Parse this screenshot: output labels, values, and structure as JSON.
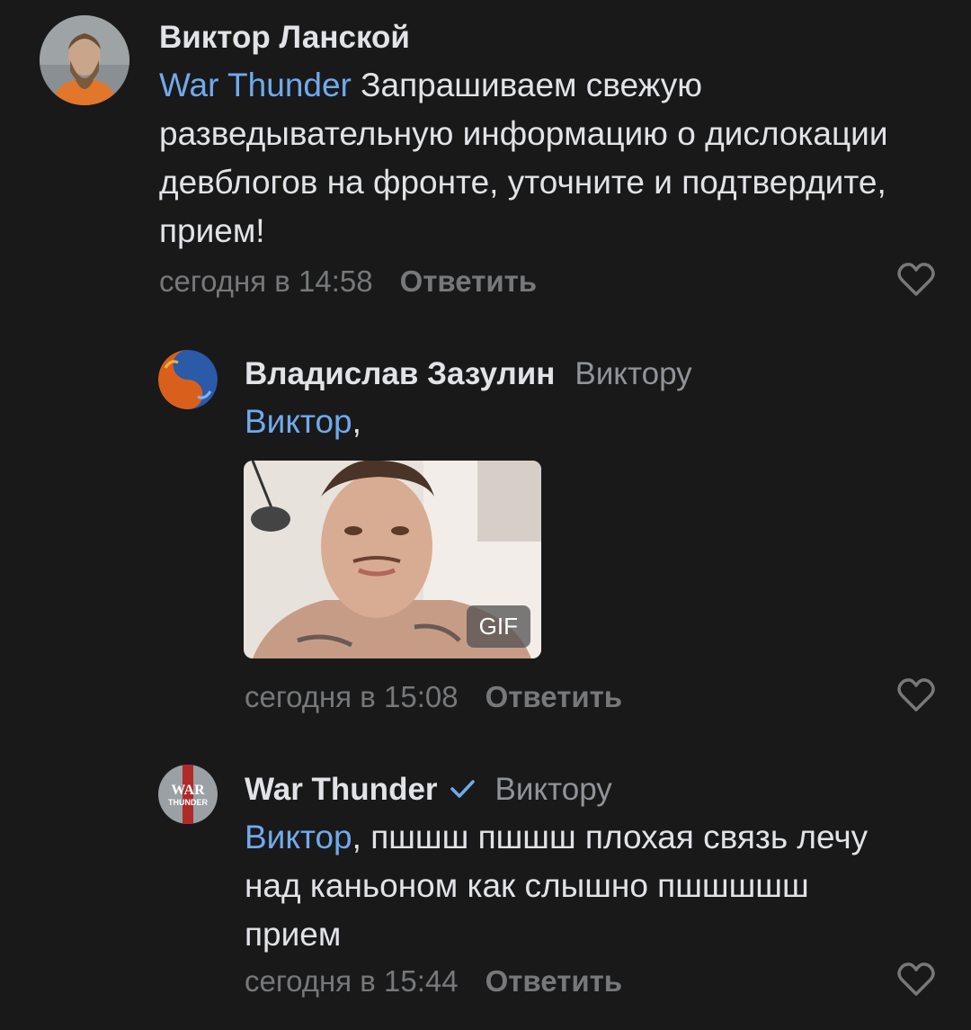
{
  "comments": [
    {
      "author": "Виктор Ланской",
      "reply_to": "",
      "mention": "War Thunder",
      "text": " Запрашиваем свежую разведывательную информацию о дислокации девблогов на фронте, уточните и подтвердите, прием!",
      "time": "сегодня в 14:58",
      "reply_label": "Ответить"
    },
    {
      "author": "Владислав Зазулин",
      "reply_to": "Виктору",
      "mention": "Виктор",
      "text": ",",
      "gif_label": "GIF",
      "time": "сегодня в 15:08",
      "reply_label": "Ответить"
    },
    {
      "author": "War Thunder",
      "verified": true,
      "reply_to": "Виктору",
      "mention": "Виктор",
      "text": ", пшшш пшшш плохая связь лечу над каньоном как слышно пшшшшш прием",
      "time": "сегодня в 15:44",
      "reply_label": "Ответить",
      "avatar_logo": "WAR THUNDER"
    }
  ],
  "colors": {
    "background": "#19191a",
    "text": "#e1e3e6",
    "secondary": "#76787a",
    "mention": "#71aaeb"
  },
  "icons": [
    "heart-icon",
    "verified-check-icon"
  ]
}
